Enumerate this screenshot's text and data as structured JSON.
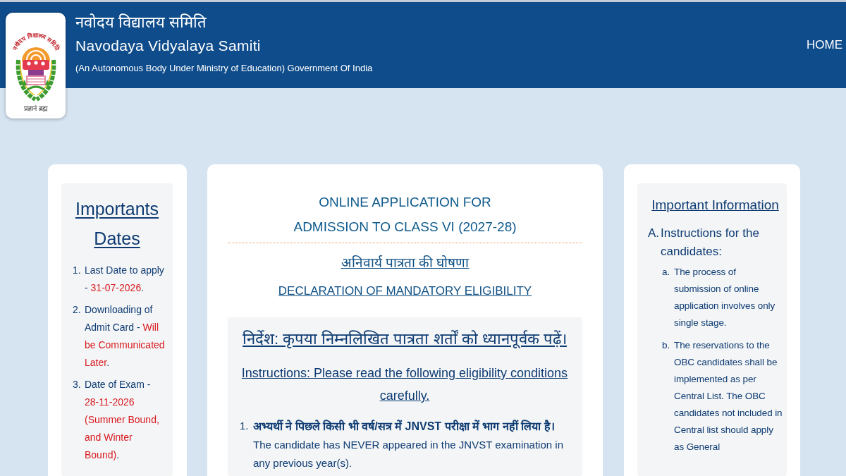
{
  "header": {
    "logo": {
      "arc_text": "नवोदय विद्यालय समिति",
      "motto": "प्रज्ञानं ब्रह्म"
    },
    "title_hindi": "नवोदय विद्यालय समिति",
    "title": "Navodaya Vidyalaya Samiti",
    "subtitle": "(An Autonomous Body Under Ministry of Education) Government Of India",
    "nav": [
      {
        "label": "HOME"
      }
    ]
  },
  "important_dates": {
    "heading": "Importants Dates",
    "items": [
      {
        "marker": "1.",
        "parts": [
          {
            "text": "Last Date to apply - ",
            "highlight": false
          },
          {
            "text": "31-07-2026",
            "highlight": true
          },
          {
            "text": ".",
            "highlight": false
          }
        ]
      },
      {
        "marker": "2.",
        "parts": [
          {
            "text": "Downloading of Admit Card - ",
            "highlight": false
          },
          {
            "text": "Will be Communicated Later",
            "highlight": true
          },
          {
            "text": ".",
            "highlight": false
          }
        ]
      },
      {
        "marker": "3.",
        "parts": [
          {
            "text": "Date of Exam - ",
            "highlight": false
          },
          {
            "text": "28-11-2026 (Summer Bound, and Winter Bound)",
            "highlight": true
          },
          {
            "text": ".",
            "highlight": false
          }
        ]
      }
    ]
  },
  "application": {
    "title_lines": [
      "ONLINE APPLICATION FOR",
      "ADMISSION TO CLASS VI (2027-28)"
    ],
    "declaration_hindi": "अनिवार्य पात्रता की घोषणा",
    "declaration": "DECLARATION OF MANDATORY ELIGIBILITY",
    "instructions_hindi": "निर्देश: कृपया निम्नलिखित पात्रता शर्तों को ध्यानपूर्वक पढ़ें।",
    "instructions": "Instructions: Please read the following eligibility conditions carefully.",
    "conditions": [
      {
        "marker": "1.",
        "text_hindi": "अभ्यर्थी ने पिछले किसी भी वर्ष/सत्र में JNVST परीक्षा में भाग नहीं लिया है।",
        "text": "The candidate has NEVER appeared in the JNVST examination in any previous year(s)."
      }
    ]
  },
  "important_information": {
    "heading": "Important Information",
    "sections": [
      {
        "marker": "A.",
        "title": "Instructions for the candidates:",
        "children": [
          {
            "marker": "a.",
            "text": "The process of submission of online application involves only single stage."
          },
          {
            "marker": "b.",
            "text": "The reservations to the OBC candidates shall be implemented as per Central List. The OBC candidates not included in Central list should apply as General"
          }
        ]
      }
    ]
  }
}
